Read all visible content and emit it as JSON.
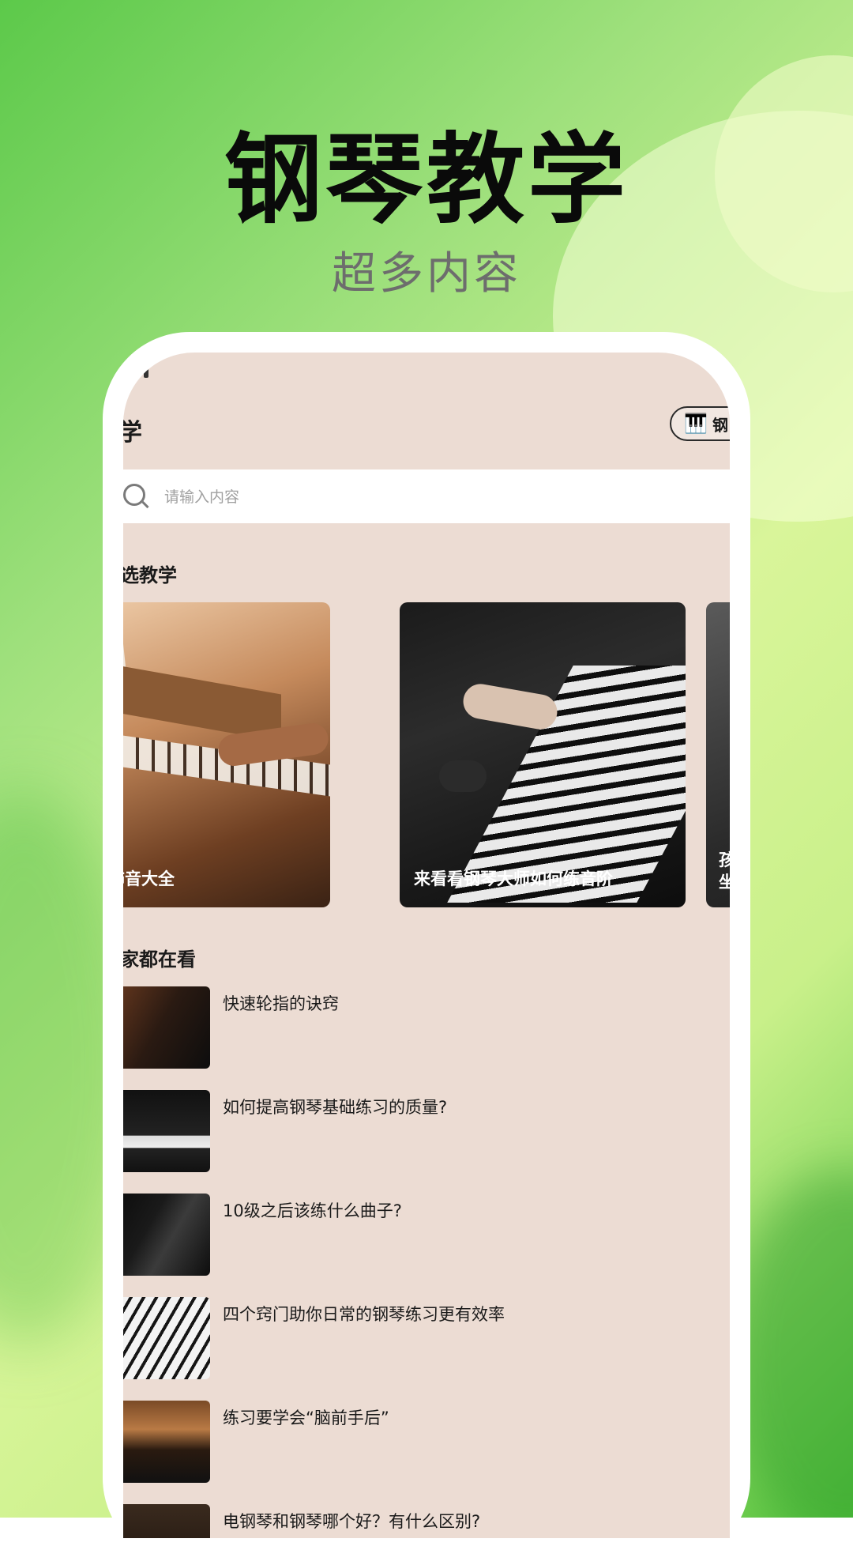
{
  "promo": {
    "headline": "钢琴教学",
    "subtitle": "超多内容"
  },
  "app": {
    "title_visible": "学",
    "chip_icon": "piano-icon",
    "chip_text": "钢"
  },
  "search": {
    "placeholder": "请输入内容"
  },
  "sections": {
    "featured_title": "选教学",
    "popular_title": "家都在看"
  },
  "featured_cards": [
    {
      "title": "用的装饰音大全"
    },
    {
      "title": "来看看钢琴大师如何练音阶"
    },
    {
      "title": "孩坐"
    }
  ],
  "popular_list": [
    {
      "title": "快速轮指的诀窍"
    },
    {
      "title": "如何提高钢琴基础练习的质量?"
    },
    {
      "title": "10级之后该练什么曲子?"
    },
    {
      "title": "四个窍门助你日常的钢琴练习更有效率"
    },
    {
      "title": "练习要学会“脑前手后”"
    },
    {
      "title": "电钢琴和钢琴哪个好？有什么区别?"
    }
  ],
  "colors": {
    "screen_bg": "#ecdcd3",
    "headline": "#0a0a0a",
    "subtitle": "#6d6d6d"
  }
}
